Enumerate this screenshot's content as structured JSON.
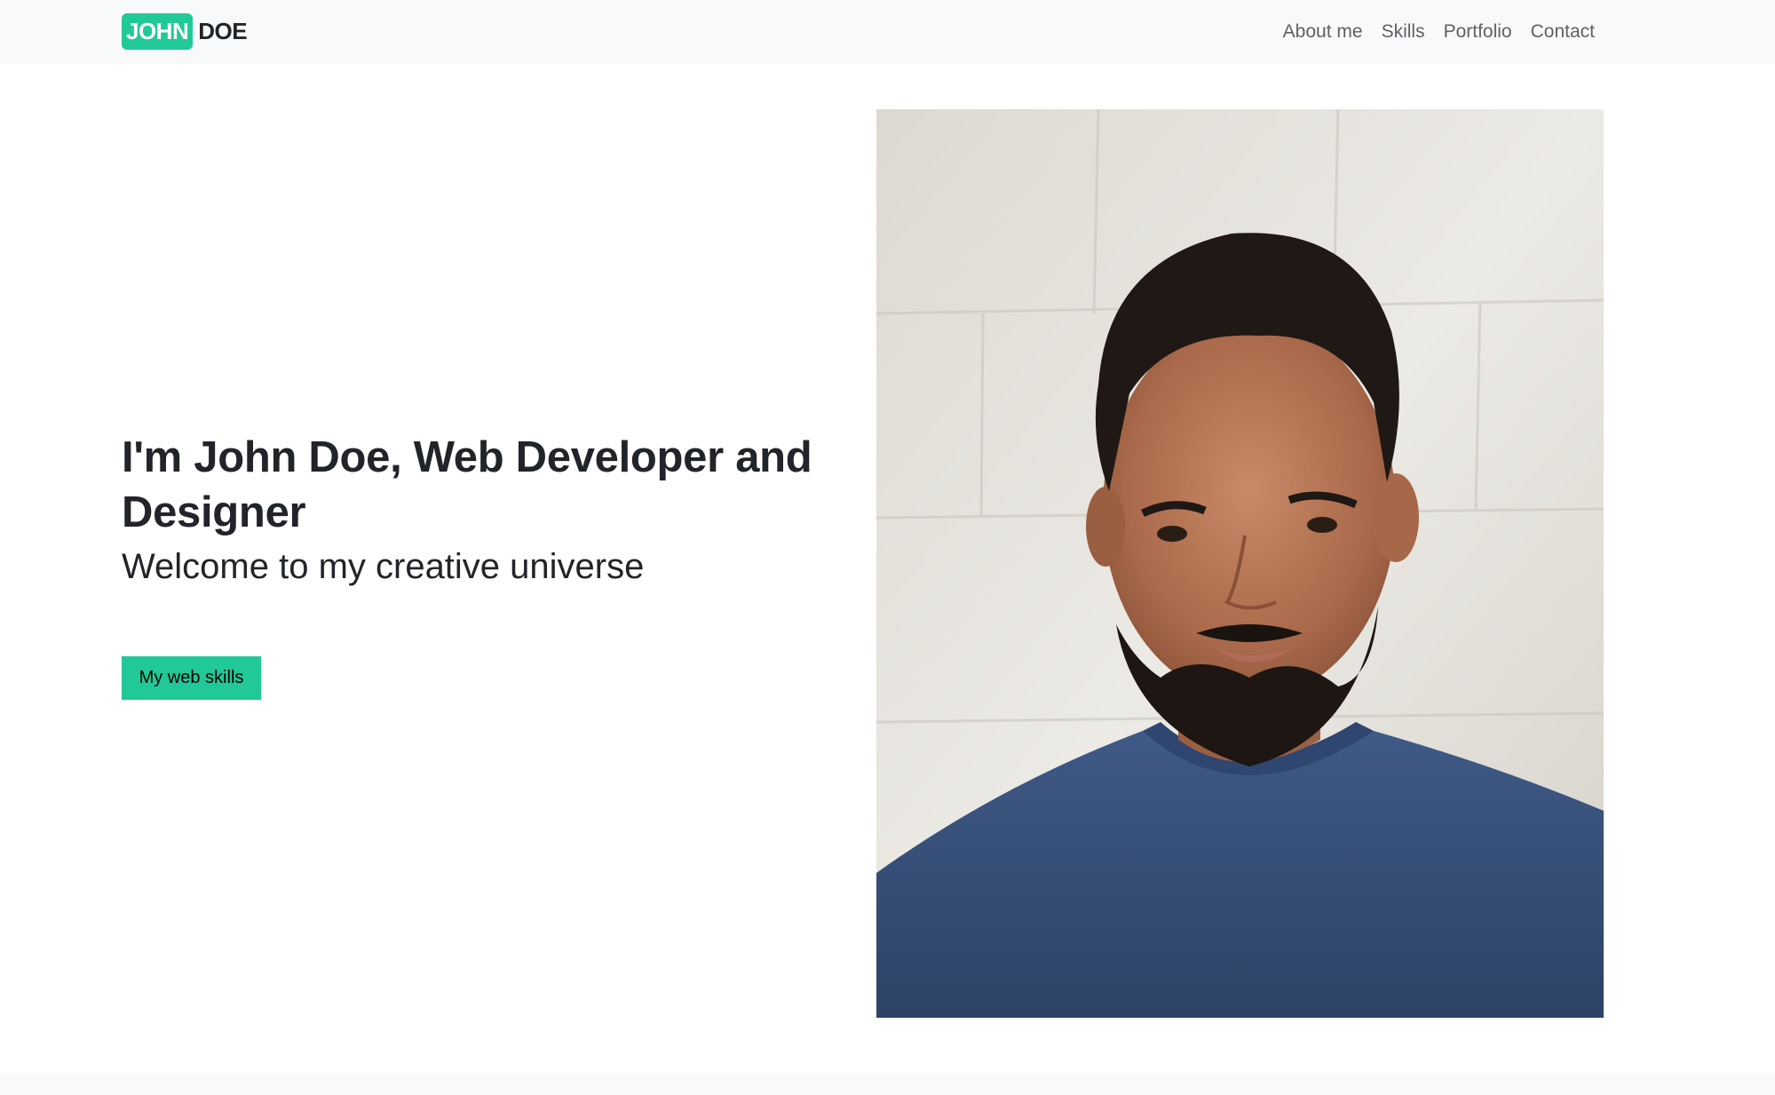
{
  "brand": {
    "first": "JOHN",
    "last": "DOE",
    "accent_color": "#20c997"
  },
  "nav": {
    "items": [
      {
        "label": "About me"
      },
      {
        "label": "Skills"
      },
      {
        "label": "Portfolio"
      },
      {
        "label": "Contact"
      }
    ]
  },
  "hero": {
    "title": "I'm John Doe, Web Developer and Designer",
    "subtitle": "Welcome to my creative universe",
    "button_label": "My web skills",
    "image_icon": "portrait-photo"
  }
}
